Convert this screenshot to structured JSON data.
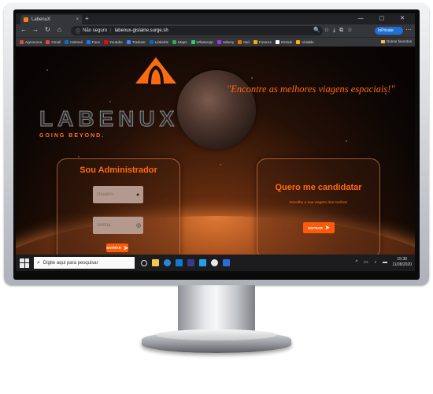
{
  "browser": {
    "tab_title": "LabenuX",
    "tab_close": "×",
    "new_tab": "+",
    "window_controls": "— ▢ ✕",
    "nav": {
      "back": "←",
      "forward": "→",
      "reload": "↻",
      "home": "⌂"
    },
    "security": "Não seguro",
    "url": "labenux-gislaine.surge.sh",
    "inprivate": "InPrivate",
    "more": "···",
    "bookmarks": [
      {
        "label": "Agronoma",
        "color": "#e04a3a"
      },
      {
        "label": "Gmail",
        "color": "#ea4335"
      },
      {
        "label": "Hotmail",
        "color": "#0f6cbd"
      },
      {
        "label": "Face",
        "color": "#1877f2"
      },
      {
        "label": "Youtube",
        "color": "#ff0000"
      },
      {
        "label": "Tradutor",
        "color": "#4285f4"
      },
      {
        "label": "LinkedIn",
        "color": "#0a66c2"
      },
      {
        "label": "Maps",
        "color": "#34a853"
      },
      {
        "label": "WhatsApp",
        "color": "#25d366"
      },
      {
        "label": "Udemy",
        "color": "#a435f0"
      },
      {
        "label": "Itaú",
        "color": "#ec7000"
      },
      {
        "label": "Future4",
        "color": "#f0b400"
      },
      {
        "label": "GitHub",
        "color": "#ffffff"
      },
      {
        "label": "Airtable",
        "color": "#fcb400"
      }
    ],
    "other_favorites": "Outros favoritos"
  },
  "page": {
    "brand": "LABENUX",
    "tagline": "GOING BEYOND.",
    "slogan": "\"Encontre as melhores viagens espaciais!\"",
    "admin_card": {
      "title": "Sou Administrador",
      "user_placeholder": "Usuário",
      "password_placeholder": "Senha",
      "button": "ENTRAR"
    },
    "candidate_card": {
      "title": "Quero me candidatar",
      "subtitle": "Escolha a sua viagem dos sonhos",
      "button": "ENTRAR"
    }
  },
  "taskbar": {
    "search_placeholder": "Digite aqui para pesquisar",
    "time": "15:39",
    "date": "11/08/2020",
    "icon_colors": [
      "#f2c94c",
      "#2b88d8",
      "#0f7bd6",
      "#3a3a8c",
      "#22a0f0",
      "#e8e8e8",
      "#2f6bd6"
    ]
  },
  "colors": {
    "accent": "#ff6a10",
    "button": "#ff5a0a"
  }
}
